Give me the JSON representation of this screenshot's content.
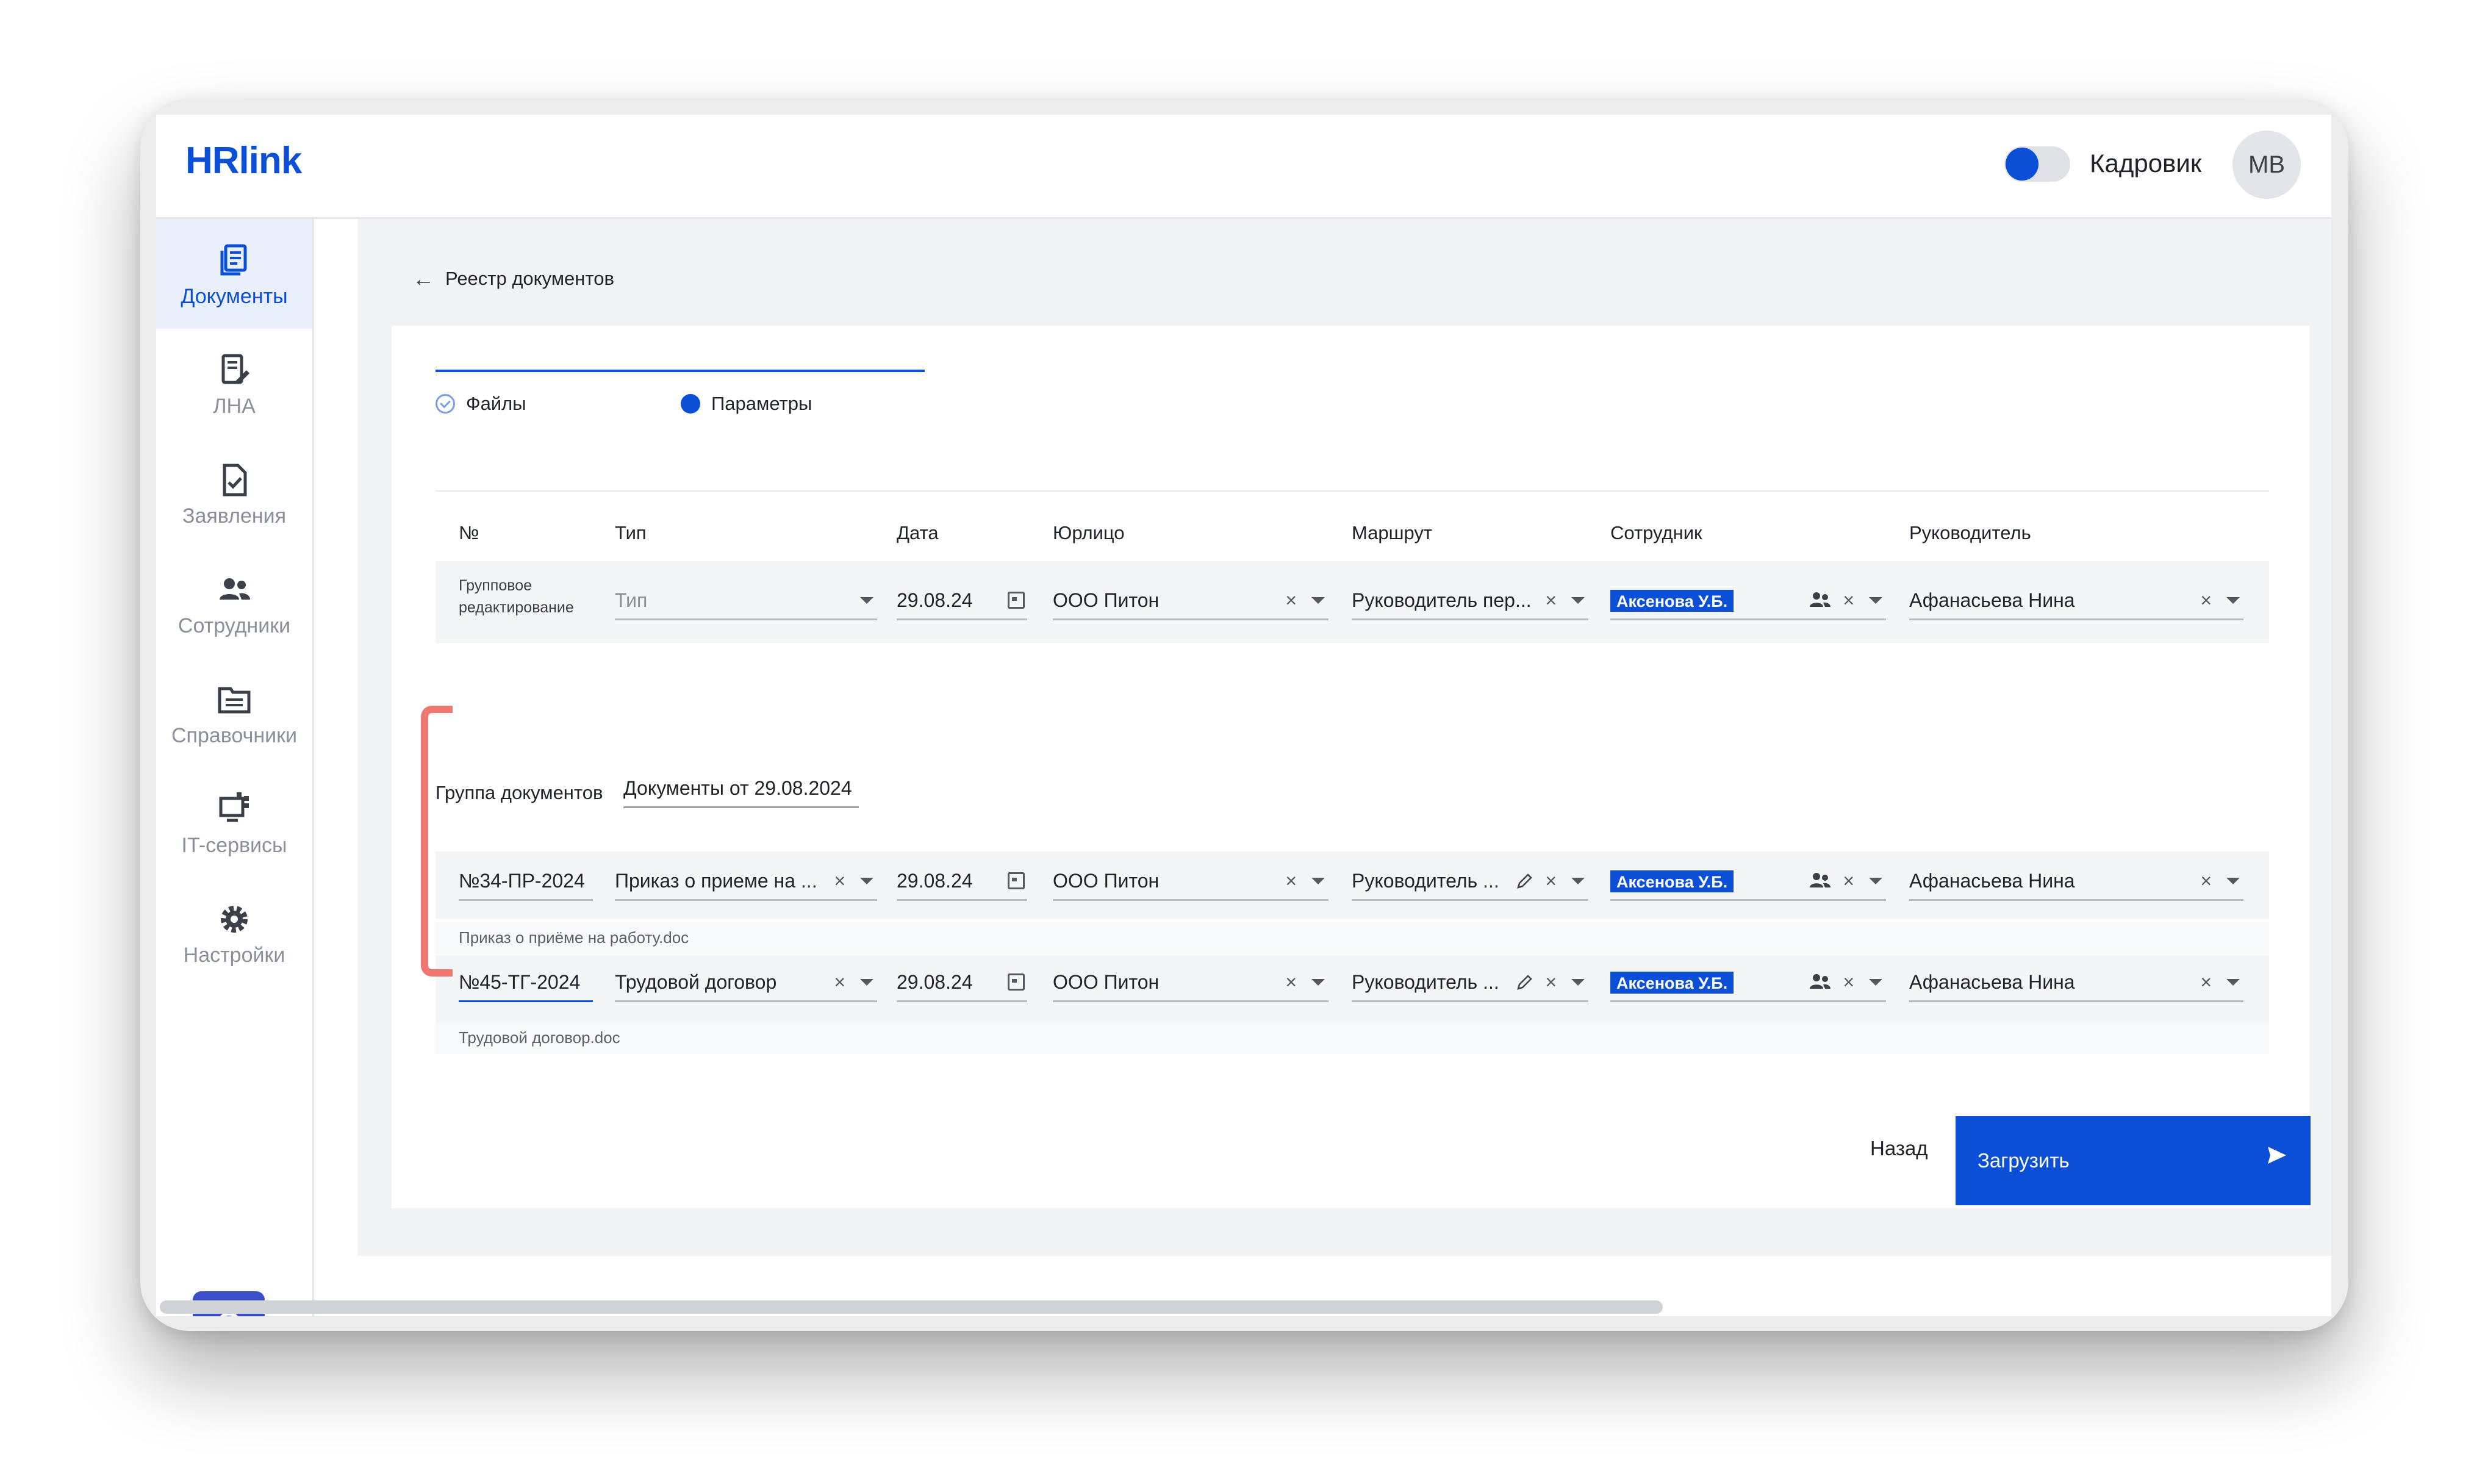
{
  "header": {
    "logo": "HRlink",
    "role_toggle_label": "Кадровик",
    "avatar_initials": "MB"
  },
  "sidebar": {
    "items": [
      {
        "label": "Документы",
        "icon": "documents-icon",
        "active": true
      },
      {
        "label": "ЛНА",
        "icon": "lna-icon",
        "active": false
      },
      {
        "label": "Заявления",
        "icon": "applications-icon",
        "active": false
      },
      {
        "label": "Сотрудники",
        "icon": "employees-icon",
        "active": false
      },
      {
        "label": "Справочники",
        "icon": "directories-icon",
        "active": false
      },
      {
        "label": "IT-сервисы",
        "icon": "it-services-icon",
        "active": false
      },
      {
        "label": "Настройки",
        "icon": "settings-icon",
        "active": false
      }
    ],
    "help": "?"
  },
  "breadcrumb": {
    "back_label": "Реестр документов"
  },
  "steps": [
    {
      "label": "Файлы",
      "state": "done"
    },
    {
      "label": "Параметры",
      "state": "active"
    }
  ],
  "table": {
    "headers": [
      "№",
      "Тип",
      "Дата",
      "Юрлицо",
      "Маршрут",
      "Сотрудник",
      "Руководитель"
    ],
    "group_edit": {
      "label": "Групповое редактирование",
      "type_placeholder": "Тип",
      "date": "29.08.24",
      "legal_entity": "ООО Питон",
      "route": "Руководитель пер...",
      "employee": "Аксенова У.Б.",
      "manager": "Афанасьева Нина"
    },
    "group": {
      "label": "Группа документов",
      "value": "Документы от 29.08.2024"
    },
    "rows": [
      {
        "number": "№34-ПР-2024",
        "type": "Приказ о приеме на ...",
        "date": "29.08.24",
        "legal_entity": "ООО Питон",
        "route": "Руководитель ...",
        "employee": "Аксенова У.Б.",
        "manager": "Афанасьева Нина",
        "filename": "Приказ о приёме на работу.doc"
      },
      {
        "number": "№45-ТГ-2024",
        "type": "Трудовой договор",
        "date": "29.08.24",
        "legal_entity": "ООО Питон",
        "route": "Руководитель ...",
        "employee": "Аксенова У.Б.",
        "manager": "Афанасьева Нина",
        "filename": "Трудовой договор.doc"
      }
    ]
  },
  "actions": {
    "back": "Назад",
    "upload": "Загрузить"
  },
  "colors": {
    "accent": "#0b4fd6",
    "highlight_bracket": "#f07670",
    "help_button": "#3a4fc8"
  }
}
